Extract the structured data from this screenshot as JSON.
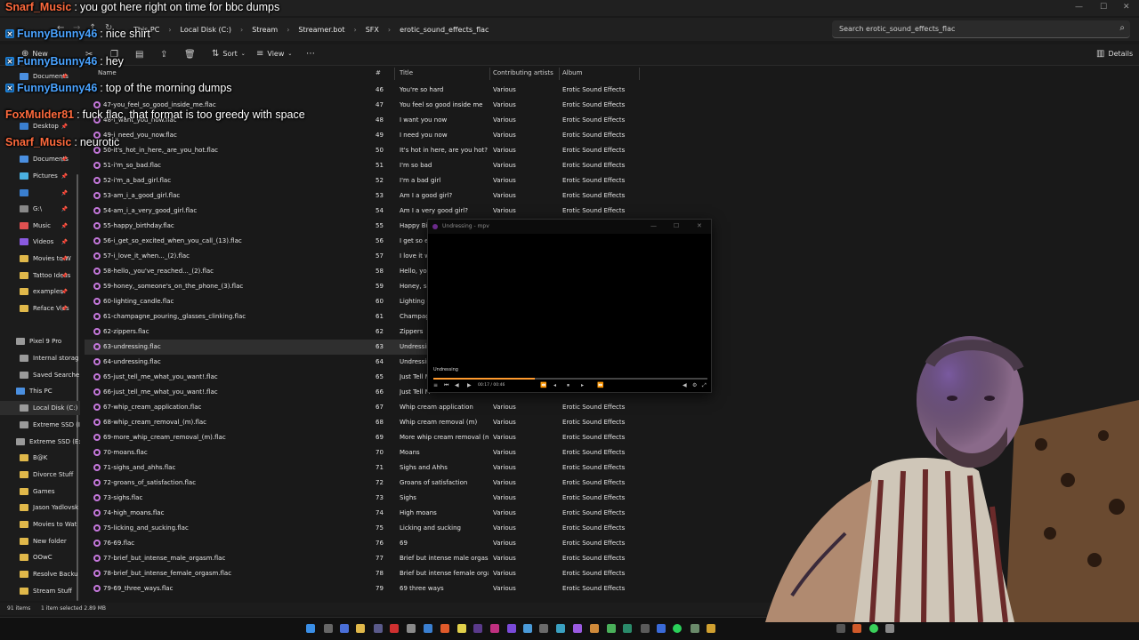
{
  "chat": [
    {
      "user": "Snarf_Music",
      "color": "#ff6a3d",
      "message": "you got here right on time for bbc dumps",
      "badge": false
    },
    {
      "user": "FunnyBunny46",
      "color": "#4aa3ff",
      "message": "nice shirt",
      "badge": true
    },
    {
      "user": "FunnyBunny46",
      "color": "#4aa3ff",
      "message": "hey",
      "badge": true
    },
    {
      "user": "FunnyBunny46",
      "color": "#4aa3ff",
      "message": "top of the morning dumps",
      "badge": true
    },
    {
      "user": "FoxMulder81",
      "color": "#ff6a3d",
      "message": "fuck flac, that format is too greedy with space",
      "badge": false
    },
    {
      "user": "Snarf_Music",
      "color": "#ff6a3d",
      "message": "neurotic",
      "badge": false
    }
  ],
  "address": {
    "crumbs": [
      "This PC",
      "Local Disk (C:)",
      "Stream",
      "Streamer.bot",
      "SFX",
      "erotic_sound_effects_flac"
    ],
    "search_placeholder": "Search erotic_sound_effects_flac"
  },
  "toolbar": {
    "new_label": "New",
    "sort_label": "Sort",
    "view_label": "View",
    "details_label": "Details"
  },
  "sidebar": {
    "items": [
      {
        "label": "Documents",
        "color": "#4a8fe0",
        "pin": true
      },
      {
        "label": "Pictures",
        "color": "#4ab0e0",
        "pin": true
      },
      {
        "label": "Desktop",
        "color": "#3a7fd0",
        "pin": true
      },
      {
        "label": "Documents",
        "color": "#4a8fe0",
        "pin": true
      },
      {
        "label": "Pictures",
        "color": "#4ab0e0",
        "pin": true
      },
      {
        "label": "",
        "color": "#3a7fd0",
        "pin": true
      },
      {
        "label": "G:\\",
        "color": "#888888",
        "pin": true
      },
      {
        "label": "Music",
        "color": "#e05050",
        "pin": true
      },
      {
        "label": "Videos",
        "color": "#8a5ae0",
        "pin": true
      },
      {
        "label": "Movies to W",
        "color": "#e0b84a",
        "pin": true
      },
      {
        "label": "Tattoo Ideas",
        "color": "#e0b84a",
        "pin": true
      },
      {
        "label": "examples",
        "color": "#e0b84a",
        "pin": true
      },
      {
        "label": "Reface Vids",
        "color": "#e0b84a",
        "pin": true
      },
      {
        "label": "Pixel 9 Pro",
        "color": "#9a9a9a",
        "pin": false
      },
      {
        "label": "Internal storag",
        "color": "#9a9a9a",
        "pin": false
      },
      {
        "label": "Saved Searche",
        "color": "#9a9a9a",
        "pin": false
      },
      {
        "label": "This PC",
        "color": "#4a8fe0",
        "pin": false
      },
      {
        "label": "Local Disk (C:)",
        "color": "#9a9a9a",
        "pin": false
      },
      {
        "label": "Extreme SSD (I",
        "color": "#9a9a9a",
        "pin": false
      },
      {
        "label": "Extreme SSD (E:)",
        "color": "#9a9a9a",
        "pin": false
      },
      {
        "label": "B@K",
        "color": "#e0b84a",
        "pin": false
      },
      {
        "label": "Divorce Stuff",
        "color": "#e0b84a",
        "pin": false
      },
      {
        "label": "Games",
        "color": "#e0b84a",
        "pin": false
      },
      {
        "label": "Jason Yadlovsk",
        "color": "#e0b84a",
        "pin": false
      },
      {
        "label": "Movies to Wat",
        "color": "#e0b84a",
        "pin": false
      },
      {
        "label": "New folder",
        "color": "#e0b84a",
        "pin": false
      },
      {
        "label": "OOwC",
        "color": "#e0b84a",
        "pin": false
      },
      {
        "label": "Resolve Backu",
        "color": "#e0b84a",
        "pin": false
      },
      {
        "label": "Stream Stuff",
        "color": "#e0b84a",
        "pin": false
      }
    ]
  },
  "columns": {
    "name": "Name",
    "num": "#",
    "title": "Title",
    "artist": "Contributing artists",
    "album": "Album"
  },
  "files": [
    {
      "name": "47-you_feel_so_good_inside_me.flac",
      "num": "47",
      "title": "You feel so good inside me",
      "artist": "Various",
      "album": "Erotic Sound Effects"
    },
    {
      "name": "48-i_want_you_now.flac",
      "num": "48",
      "title": "I want you now",
      "artist": "Various",
      "album": "Erotic Sound Effects"
    },
    {
      "name": "49-i_need_you_now.flac",
      "num": "49",
      "title": "I need you now",
      "artist": "Various",
      "album": "Erotic Sound Effects"
    },
    {
      "name": "50-it's_hot_in_here,_are_you_hot.flac",
      "num": "50",
      "title": "It's hot in here, are you hot?",
      "artist": "Various",
      "album": "Erotic Sound Effects"
    },
    {
      "name": "51-i'm_so_bad.flac",
      "num": "51",
      "title": "I'm so bad",
      "artist": "Various",
      "album": "Erotic Sound Effects"
    },
    {
      "name": "52-i'm_a_bad_girl.flac",
      "num": "52",
      "title": "I'm a bad girl",
      "artist": "Various",
      "album": "Erotic Sound Effects"
    },
    {
      "name": "53-am_i_a_good_girl.flac",
      "num": "53",
      "title": "Am I a good girl?",
      "artist": "Various",
      "album": "Erotic Sound Effects"
    },
    {
      "name": "54-am_i_a_very_good_girl.flac",
      "num": "54",
      "title": "Am I a very good girl?",
      "artist": "Various",
      "album": "Erotic Sound Effects"
    },
    {
      "name": "55-happy_birthday.flac",
      "num": "55",
      "title": "Happy Bir",
      "artist": "",
      "album": ""
    },
    {
      "name": "56-i_get_so_excited_when_you_call_(13).flac",
      "num": "56",
      "title": "I get so e",
      "artist": "",
      "album": ""
    },
    {
      "name": "57-i_love_it_when..._(2).flac",
      "num": "57",
      "title": "I love it wl",
      "artist": "",
      "album": ""
    },
    {
      "name": "58-hello,_you've_reached..._(2).flac",
      "num": "58",
      "title": "Hello, yo",
      "artist": "",
      "album": ""
    },
    {
      "name": "59-honey,_someone's_on_the_phone_(3).flac",
      "num": "59",
      "title": "Honey, so",
      "artist": "",
      "album": ""
    },
    {
      "name": "60-lighting_candle.flac",
      "num": "60",
      "title": "Lighting c",
      "artist": "",
      "album": ""
    },
    {
      "name": "61-champagne_pouring,_glasses_clinking.flac",
      "num": "61",
      "title": "Champag",
      "artist": "",
      "album": ""
    },
    {
      "name": "62-zippers.flac",
      "num": "62",
      "title": "Zippers",
      "artist": "",
      "album": ""
    },
    {
      "name": "63-undressing.flac",
      "num": "63",
      "title": "Undressin",
      "artist": "",
      "album": "",
      "selected": true
    },
    {
      "name": "64-undressing.flac",
      "num": "64",
      "title": "Undressin",
      "artist": "",
      "album": ""
    },
    {
      "name": "65-just_tell_me_what_you_want!.flac",
      "num": "65",
      "title": "Just Tell M",
      "artist": "",
      "album": ""
    },
    {
      "name": "66-just_tell_me_what_you_want!.flac",
      "num": "66",
      "title": "Just Tell M",
      "artist": "",
      "album": ""
    },
    {
      "name": "67-whip_cream_application.flac",
      "num": "67",
      "title": "Whip cream application",
      "artist": "Various",
      "album": "Erotic Sound Effects"
    },
    {
      "name": "68-whip_cream_removal_(m).flac",
      "num": "68",
      "title": "Whip cream removal (m)",
      "artist": "Various",
      "album": "Erotic Sound Effects"
    },
    {
      "name": "69-more_whip_cream_removal_(m).flac",
      "num": "69",
      "title": "More whip cream removal (m)",
      "artist": "Various",
      "album": "Erotic Sound Effects"
    },
    {
      "name": "70-moans.flac",
      "num": "70",
      "title": "Moans",
      "artist": "Various",
      "album": "Erotic Sound Effects"
    },
    {
      "name": "71-sighs_and_ahhs.flac",
      "num": "71",
      "title": "Sighs and Ahhs",
      "artist": "Various",
      "album": "Erotic Sound Effects"
    },
    {
      "name": "72-groans_of_satisfaction.flac",
      "num": "72",
      "title": "Groans of satisfaction",
      "artist": "Various",
      "album": "Erotic Sound Effects"
    },
    {
      "name": "73-sighs.flac",
      "num": "73",
      "title": "Sighs",
      "artist": "Various",
      "album": "Erotic Sound Effects"
    },
    {
      "name": "74-high_moans.flac",
      "num": "74",
      "title": "High moans",
      "artist": "Various",
      "album": "Erotic Sound Effects"
    },
    {
      "name": "75-licking_and_sucking.flac",
      "num": "75",
      "title": "Licking and sucking",
      "artist": "Various",
      "album": "Erotic Sound Effects"
    },
    {
      "name": "76-69.flac",
      "num": "76",
      "title": "69",
      "artist": "Various",
      "album": "Erotic Sound Effects"
    },
    {
      "name": "77-brief_but_intense_male_orgasm.flac",
      "num": "77",
      "title": "Brief but intense male orgasm",
      "artist": "Various",
      "album": "Erotic Sound Effects"
    },
    {
      "name": "78-brief_but_intense_female_orgasm.flac",
      "num": "78",
      "title": "Brief but intense female orgasm",
      "artist": "Various",
      "album": "Erotic Sound Effects"
    },
    {
      "name": "79-69_three_ways.flac",
      "num": "79",
      "title": "69 three ways",
      "artist": "Various",
      "album": "Erotic Sound Effects"
    }
  ],
  "top_row": {
    "num": "46",
    "title": "You're so hard",
    "artist": "Various",
    "album": "Erotic Sound Effects"
  },
  "status": {
    "items": "91 items",
    "selected": "1 item selected  2.89 MB"
  },
  "mpv": {
    "window_title": "Undressing - mpv",
    "osc_title": "Undressing",
    "time": "00:17 / 00:46",
    "progress": 0.37
  }
}
